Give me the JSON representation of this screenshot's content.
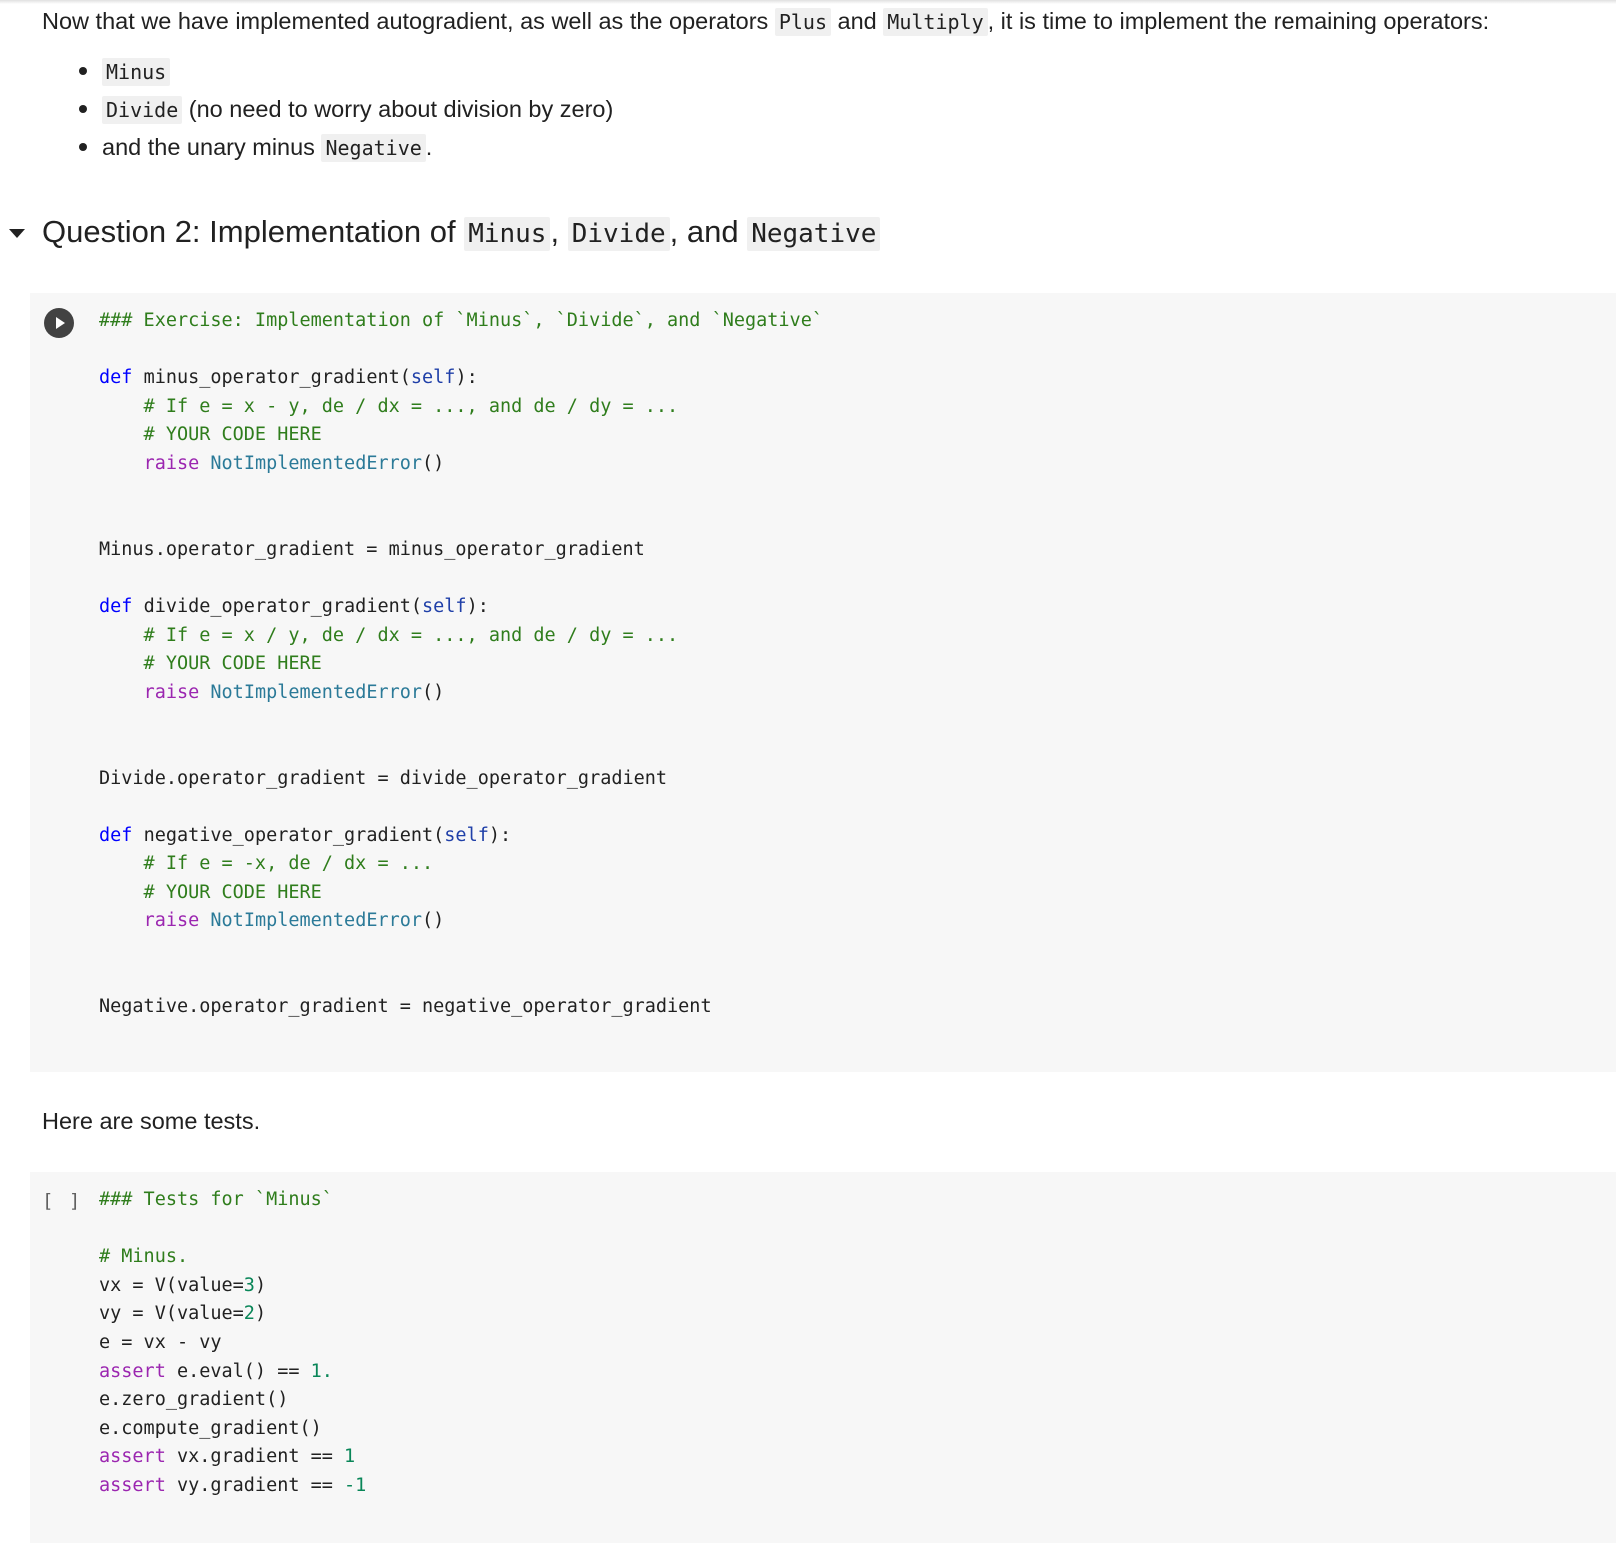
{
  "intro": {
    "text_before": "Now that we have implemented autogradient, as well as the operators ",
    "code1": "Plus",
    "text_mid": " and ",
    "code2": "Multiply",
    "text_after": ", it is time to implement the remaining operators:"
  },
  "bullets": [
    {
      "code": "Minus",
      "text": ""
    },
    {
      "code": "Divide",
      "text": " (no need to worry about division by zero)"
    },
    {
      "text_before": "and the unary minus ",
      "code": "Negative",
      "text_after": "."
    }
  ],
  "section": {
    "prefix": "Question 2: Implementation of ",
    "code1": "Minus",
    "sep1": ", ",
    "code2": "Divide",
    "sep2": ", and ",
    "code3": "Negative"
  },
  "cell1": {
    "lines": [
      "### Exercise: Implementation of `Minus`, `Divide`, and `Negative`",
      "",
      "def minus_operator_gradient(self):",
      "    # If e = x - y, de / dx = ..., and de / dy = ...",
      "    # YOUR CODE HERE",
      "    raise NotImplementedError()",
      "",
      "",
      "Minus.operator_gradient = minus_operator_gradient",
      "",
      "def divide_operator_gradient(self):",
      "    # If e = x / y, de / dx = ..., and de / dy = ...",
      "    # YOUR CODE HERE",
      "    raise NotImplementedError()",
      "",
      "",
      "Divide.operator_gradient = divide_operator_gradient",
      "",
      "def negative_operator_gradient(self):",
      "    # If e = -x, de / dx = ...",
      "    # YOUR CODE HERE",
      "    raise NotImplementedError()",
      "",
      "",
      "Negative.operator_gradient = negative_operator_gradient"
    ]
  },
  "tests_text": "Here are some tests.",
  "cell2": {
    "exec_count": "[ ]",
    "lines": [
      "### Tests for `Minus`",
      "",
      "# Minus.",
      "vx = V(value=3)",
      "vy = V(value=2)",
      "e = vx - vy",
      "assert e.eval() == 1.",
      "e.zero_gradient()",
      "e.compute_gradient()",
      "assert vx.gradient == 1",
      "assert vy.gradient == -1"
    ]
  }
}
